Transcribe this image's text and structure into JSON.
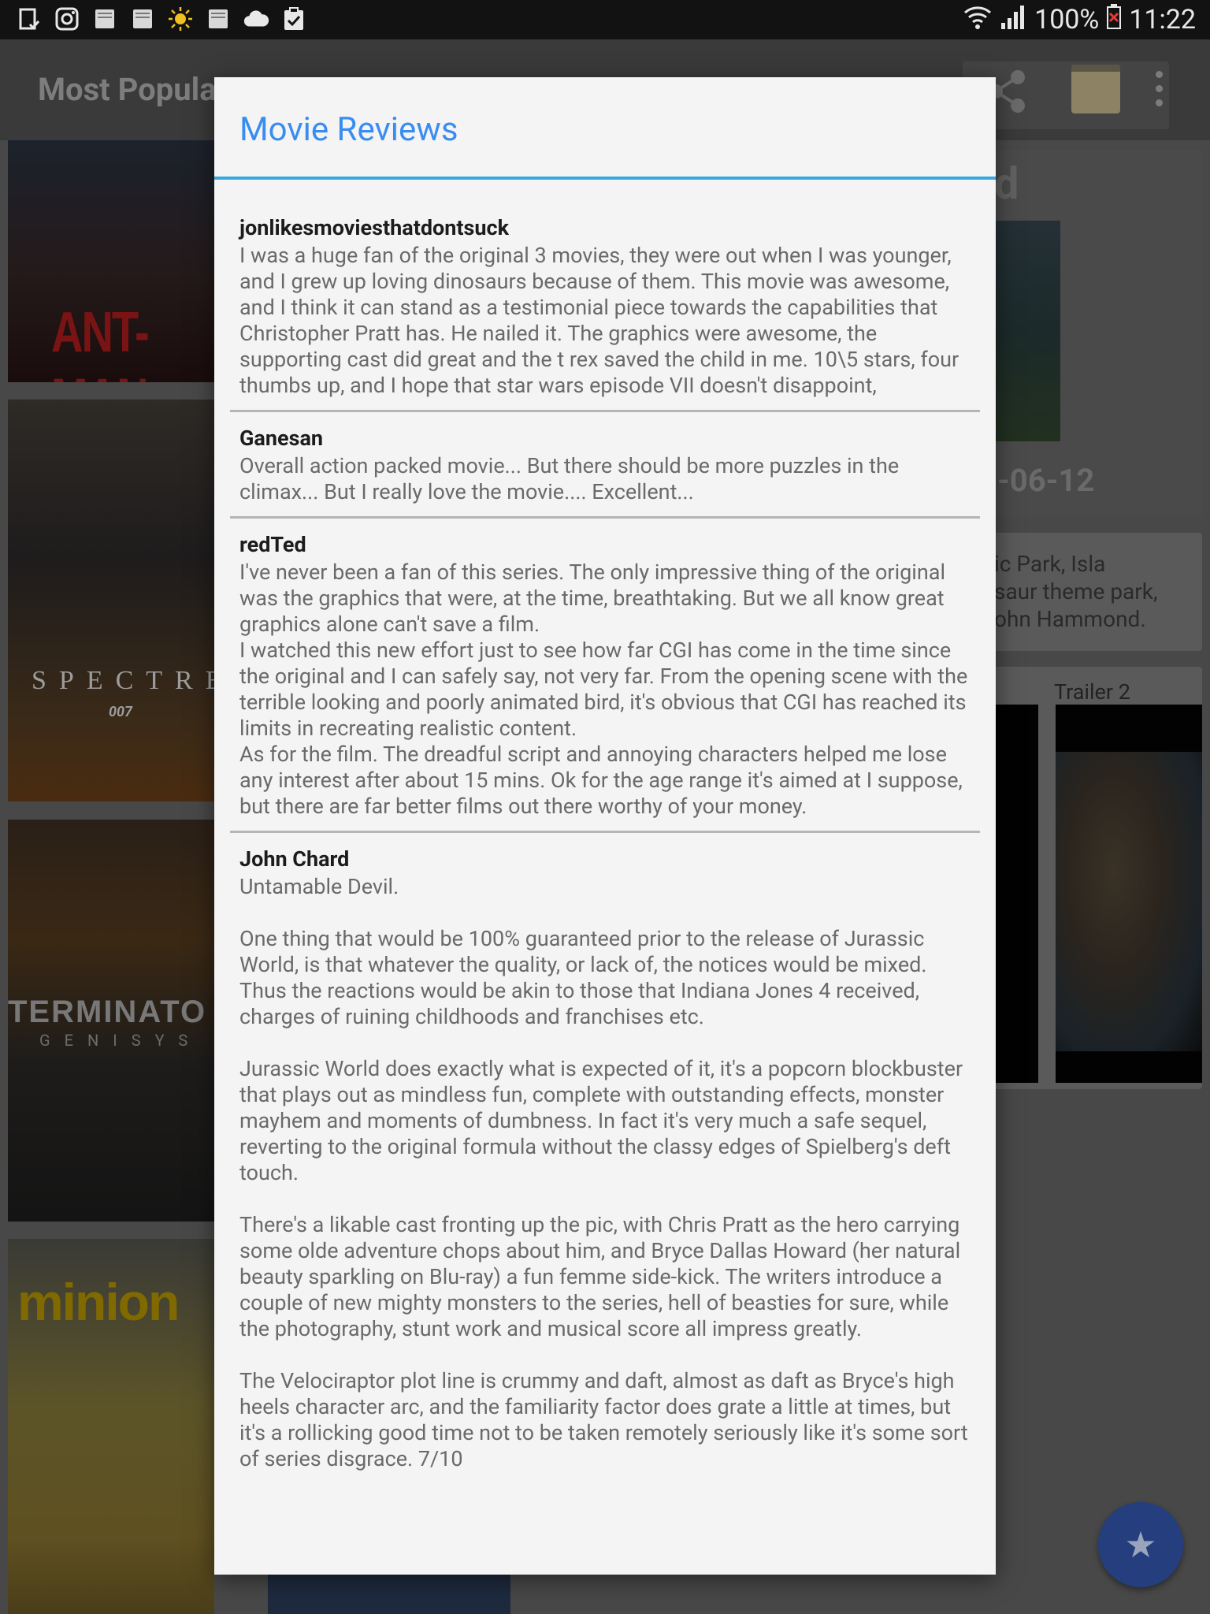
{
  "status_bar": {
    "icons_left": [
      "notification-icon",
      "instagram-icon",
      "bible-icon",
      "bible-icon",
      "brightness-icon",
      "bible-icon",
      "cloud-icon",
      "clipboard-check-icon"
    ],
    "battery": "100%",
    "time": "11:22"
  },
  "app_bar": {
    "title": "Most Popular",
    "icons": [
      "share-icon",
      "notepad-icon",
      "overflow-menu-icon"
    ]
  },
  "posters": [
    {
      "name": "Ant-Man",
      "title_text": "ANT-MAN"
    },
    {
      "name": "Spectre",
      "title_text": "SPECTRE",
      "sub_text": "007"
    },
    {
      "name": "Terminator Genisys",
      "title_text": "TERMINATO",
      "sub_text": "GENISYS"
    },
    {
      "name": "Minions",
      "title_text": "minion"
    }
  ],
  "details": {
    "title_fragment": "d",
    "release_date_fragment": "-06-12",
    "overview_fragment": "ic Park, Isla\nsaur theme park,\nohn Hammond.",
    "trailers": [
      {
        "label": ""
      },
      {
        "label": "Trailer 2"
      }
    ]
  },
  "dialog": {
    "title": "Movie Reviews",
    "accent_color": "#3aa7de",
    "reviews": [
      {
        "author": "jonlikesmoviesthatdontsuck",
        "content": "I was a huge fan of the original 3 movies, they were out when I was younger, and I grew up loving dinosaurs because of them. This movie was awesome, and I think it can stand as a testimonial piece towards the capabilities that Christopher Pratt has. He nailed it. The graphics were awesome, the supporting cast did great and the t rex saved the child in me. 10\\5 stars, four thumbs up, and I hope that star wars episode VII doesn't disappoint,"
      },
      {
        "author": "Ganesan",
        "content": "Overall action packed movie... But there should be more puzzles in the climax... But I really love the movie.... Excellent..."
      },
      {
        "author": "redTed",
        "content": "I've never been a fan of this series. The only impressive thing of the original was the graphics that were, at the time, breathtaking. But we all know great graphics alone can't save a film.\nI watched this new effort just to see how far CGI has come in the time since the original and I can safely say, not very far. From the opening scene with the terrible looking and poorly animated bird, it's obvious that CGI has reached its limits in recreating realistic content.\nAs for the film. The dreadful script and annoying characters helped me lose any interest after about 15 mins. Ok for the age range it's aimed at I suppose, but there are far better films out there worthy of your money."
      },
      {
        "author": "John Chard",
        "content": "Untamable Devil.\n\nOne thing that would be 100% guaranteed prior to the release of Jurassic World, is that whatever the quality, or lack of, the notices would be mixed. Thus the reactions would be akin to those that Indiana Jones 4 received, charges of ruining childhoods and franchises etc.\n\nJurassic World does exactly what is expected of it, it's a popcorn blockbuster that plays out as mindless fun, complete with outstanding effects, monster mayhem and moments of dumbness. In fact it's very much a safe sequel, reverting to the original formula without the classy edges of Spielberg's deft touch.\n\nThere's a likable cast fronting up the pic, with Chris Pratt as the hero carrying some olde adventure chops about him, and Bryce Dallas Howard (her natural beauty sparkling on Blu-ray) a fun femme side-kick. The writers introduce a couple of new mighty monsters to the series, hell of beasties for sure, while the photography, stunt work and musical score all impress greatly.\n\nThe Velociraptor plot line is crummy and daft, almost as daft as Bryce's high heels character arc, and the familiarity factor does grate a little at times, but it's a rollicking good time not to be taken remotely seriously like it's some sort of series disgrace. 7/10"
      }
    ]
  },
  "fab": {
    "icon": "star-icon",
    "glyph": "★"
  }
}
